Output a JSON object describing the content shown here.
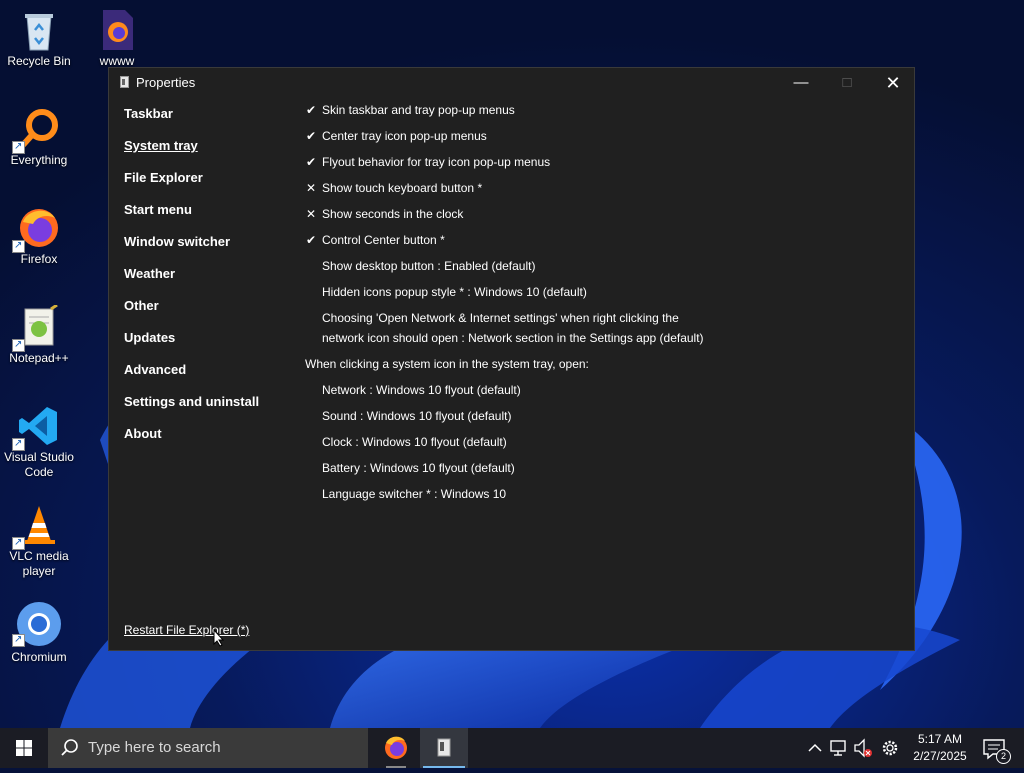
{
  "desktop": {
    "icons": [
      {
        "label": "Recycle Bin"
      },
      {
        "label": "wwww"
      },
      {
        "label": "Everything"
      },
      {
        "label": "Firefox"
      },
      {
        "label": "Notepad++"
      },
      {
        "label": "Visual Studio Code"
      },
      {
        "label": "VLC media player"
      },
      {
        "label": "Chromium"
      }
    ]
  },
  "window": {
    "title": "Properties",
    "controls": {
      "minimize": "—",
      "maximize": "□",
      "close": "✕"
    },
    "nav": [
      {
        "label": "Taskbar",
        "active": false
      },
      {
        "label": "System tray",
        "active": true
      },
      {
        "label": "File Explorer",
        "active": false
      },
      {
        "label": "Start menu",
        "active": false
      },
      {
        "label": "Window switcher",
        "active": false
      },
      {
        "label": "Weather",
        "active": false
      },
      {
        "label": "Other",
        "active": false
      },
      {
        "label": "Updates",
        "active": false
      },
      {
        "label": "Advanced",
        "active": false
      },
      {
        "label": "Settings and uninstall",
        "active": false
      },
      {
        "label": "About",
        "active": false
      }
    ],
    "options": [
      {
        "mark": "✔",
        "label": "Skin taskbar and tray pop-up menus"
      },
      {
        "mark": "✔",
        "label": "Center tray icon pop-up menus"
      },
      {
        "mark": "✔",
        "label": "Flyout behavior for tray icon pop-up menus"
      },
      {
        "mark": "✕",
        "label": "Show touch keyboard button *"
      },
      {
        "mark": "✕",
        "label": "Show seconds in the clock"
      },
      {
        "mark": "✔",
        "label": "Control Center button *"
      },
      {
        "mark": "",
        "label": "Show desktop button : Enabled (default)"
      },
      {
        "mark": "",
        "label": "Hidden icons popup style * : Windows 10 (default)"
      },
      {
        "mark": "",
        "label": "Choosing 'Open Network & Internet settings' when right clicking the",
        "label2": "network icon should open : Network section in the Settings app (default)"
      }
    ],
    "section_heading": "When clicking a system icon in the system tray, open:",
    "sub_options": [
      {
        "label": "Network : Windows 10 flyout (default)"
      },
      {
        "label": "Sound : Windows 10 flyout (default)"
      },
      {
        "label": "Clock : Windows 10 flyout (default)"
      },
      {
        "label": "Battery : Windows 10 flyout (default)"
      },
      {
        "label": "Language switcher * : Windows 10"
      }
    ],
    "restart_link": "Restart File Explorer (*)"
  },
  "taskbar": {
    "search_placeholder": "Type here to search",
    "time": "5:17 AM",
    "date": "2/27/2025",
    "notification_count": "2"
  },
  "colors": {
    "window_bg": "#202020",
    "taskbar_bg": "#1b1c24",
    "search_bg": "#3a3a3a",
    "accent": "#76b9ed"
  }
}
